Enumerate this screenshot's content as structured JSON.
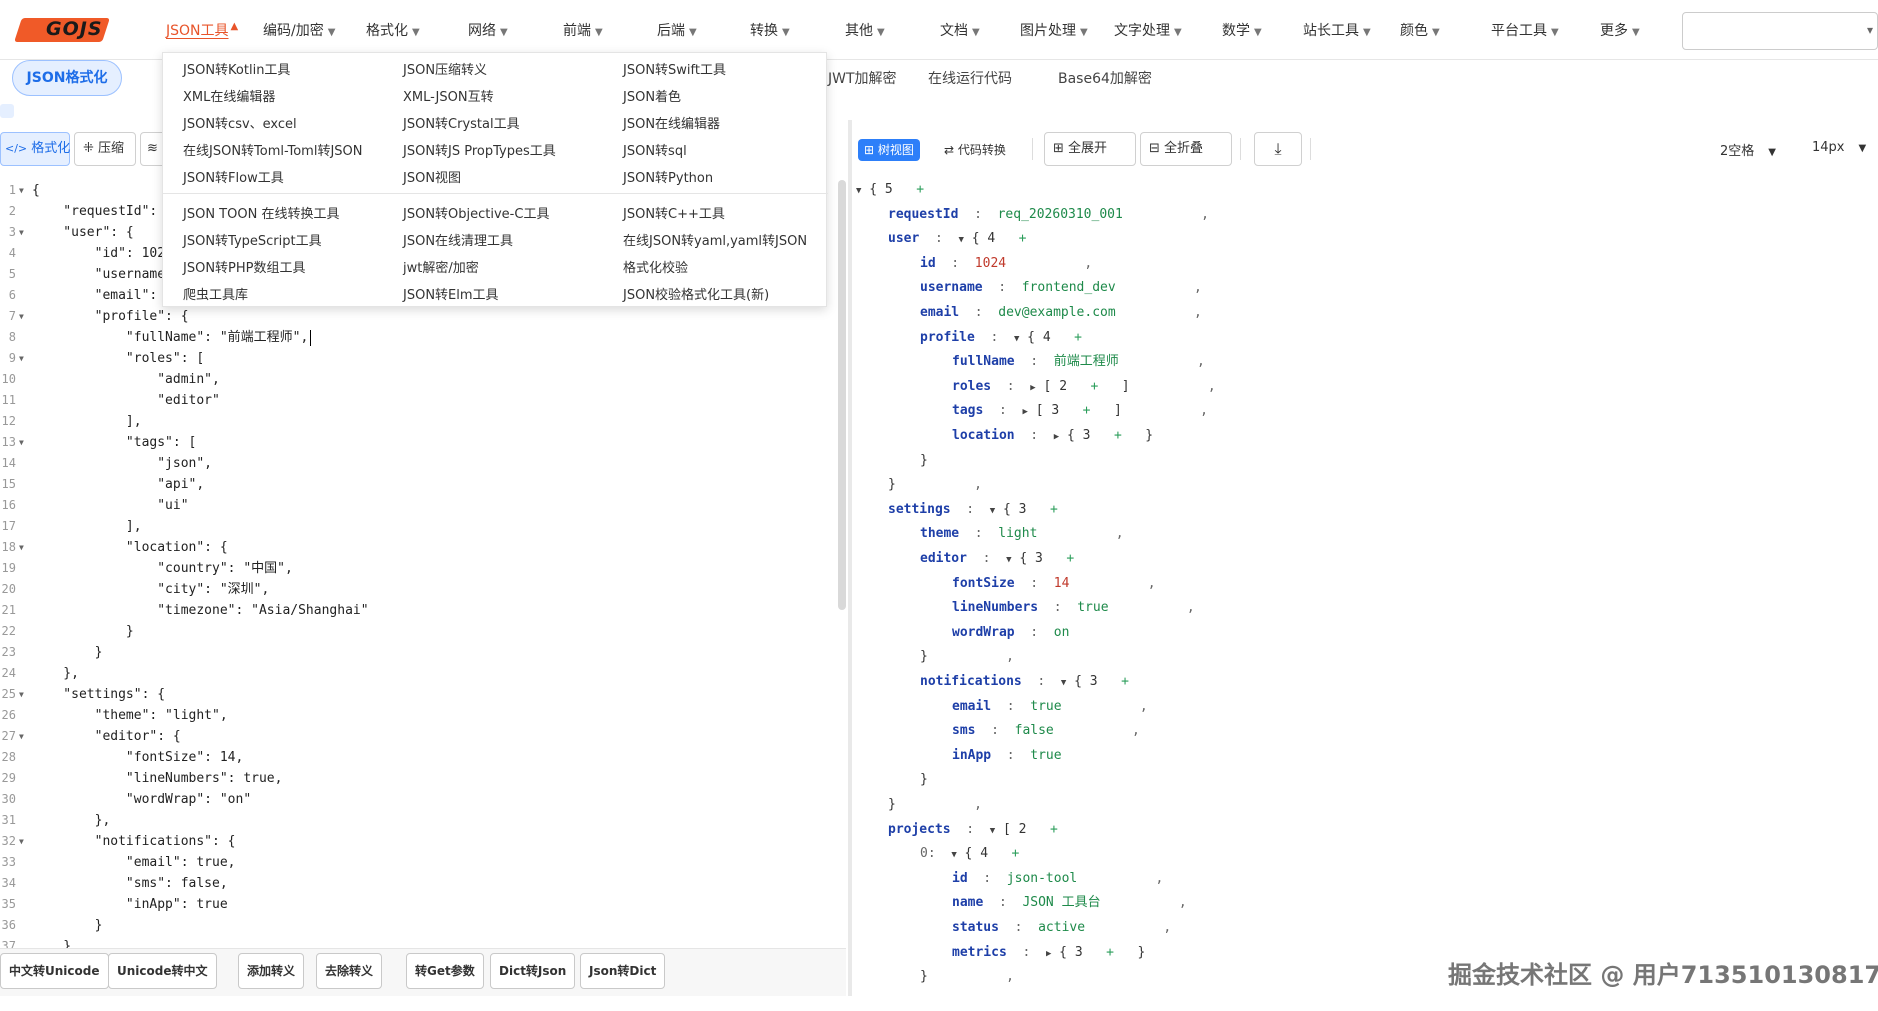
{
  "logo": {
    "text": "GOJS"
  },
  "nav": [
    {
      "label": "JSON工具",
      "active": true
    },
    {
      "label": "编码/加密"
    },
    {
      "label": "格式化"
    },
    {
      "label": "网络"
    },
    {
      "label": "前端"
    },
    {
      "label": "后端"
    },
    {
      "label": "转换"
    },
    {
      "label": "其他"
    },
    {
      "label": "文档"
    },
    {
      "label": "图片处理"
    },
    {
      "label": "文字处理"
    },
    {
      "label": "数学"
    },
    {
      "label": "站长工具"
    },
    {
      "label": "颜色"
    },
    {
      "label": "平台工具"
    },
    {
      "label": "更多"
    }
  ],
  "subtabs": {
    "active": "JSON格式化",
    "items": [
      "JWT加解密",
      "在线运行代码",
      "Base64加解密"
    ]
  },
  "dropdown": {
    "col1": [
      "JSON转Kotlin工具",
      "XML在线编辑器",
      "JSON转csv、excel",
      "在线JSON转Toml-Toml转JSON",
      "JSON转Flow工具",
      "JSON TOON 在线转换工具",
      "JSON转TypeScript工具",
      "JSON转PHP数组工具",
      "爬虫工具库"
    ],
    "col2": [
      "JSON压缩转义",
      "XML-JSON互转",
      "JSON转Crystal工具",
      "JSON转JS PropTypes工具",
      "JSON视图",
      "JSON转Objective-C工具",
      "JSON在线清理工具",
      "jwt解密/加密",
      "JSON转Elm工具"
    ],
    "col3": [
      "JSON转Swift工具",
      "JSON着色",
      "JSON在线编辑器",
      "JSON转sql",
      "JSON转Python",
      "JSON转C++工具",
      "在线JSON转yaml,yaml转JSON",
      "格式化校验",
      "JSON校验格式化工具(新)"
    ]
  },
  "left_toolbar": {
    "format": "格式化",
    "compress": "压缩"
  },
  "right_toolbar": {
    "tree_view": "树视图",
    "code_convert": "代码转换",
    "expand_all": "全展开",
    "collapse_all": "全折叠",
    "indent": "2空格",
    "font_size": "14px"
  },
  "editor_lines": [
    {
      "n": "1",
      "fold": true,
      "code": "{"
    },
    {
      "n": "2",
      "code": "    \"requestId\":"
    },
    {
      "n": "3",
      "fold": true,
      "code": "    \"user\": {"
    },
    {
      "n": "4",
      "code": "        \"id\": 102"
    },
    {
      "n": "5",
      "code": "        \"username"
    },
    {
      "n": "6",
      "code": "        \"email\":"
    },
    {
      "n": "7",
      "fold": true,
      "code": "        \"profile\": {"
    },
    {
      "n": "8",
      "code": "            \"fullName\": \"前端工程师\","
    },
    {
      "n": "9",
      "fold": true,
      "code": "            \"roles\": ["
    },
    {
      "n": "10",
      "code": "                \"admin\","
    },
    {
      "n": "11",
      "code": "                \"editor\""
    },
    {
      "n": "12",
      "code": "            ],"
    },
    {
      "n": "13",
      "fold": true,
      "code": "            \"tags\": ["
    },
    {
      "n": "14",
      "code": "                \"json\","
    },
    {
      "n": "15",
      "code": "                \"api\","
    },
    {
      "n": "16",
      "code": "                \"ui\""
    },
    {
      "n": "17",
      "code": "            ],"
    },
    {
      "n": "18",
      "fold": true,
      "code": "            \"location\": {"
    },
    {
      "n": "19",
      "code": "                \"country\": \"中国\","
    },
    {
      "n": "20",
      "code": "                \"city\": \"深圳\","
    },
    {
      "n": "21",
      "code": "                \"timezone\": \"Asia/Shanghai\""
    },
    {
      "n": "22",
      "code": "            }"
    },
    {
      "n": "23",
      "code": "        }"
    },
    {
      "n": "24",
      "code": "    },"
    },
    {
      "n": "25",
      "fold": true,
      "code": "    \"settings\": {"
    },
    {
      "n": "26",
      "code": "        \"theme\": \"light\","
    },
    {
      "n": "27",
      "fold": true,
      "code": "        \"editor\": {"
    },
    {
      "n": "28",
      "code": "            \"fontSize\": 14,"
    },
    {
      "n": "29",
      "code": "            \"lineNumbers\": true,"
    },
    {
      "n": "30",
      "code": "            \"wordWrap\": \"on\""
    },
    {
      "n": "31",
      "code": "        },"
    },
    {
      "n": "32",
      "fold": true,
      "code": "        \"notifications\": {"
    },
    {
      "n": "33",
      "code": "            \"email\": true,"
    },
    {
      "n": "34",
      "code": "            \"sms\": false,"
    },
    {
      "n": "35",
      "code": "            \"inApp\": true"
    },
    {
      "n": "36",
      "code": "        }"
    },
    {
      "n": "37",
      "code": "    },"
    }
  ],
  "bottom_buttons": [
    "中文转Unicode",
    "Unicode转中文",
    "添加转义",
    "去除转义",
    "转Get参数",
    "Dict转Json",
    "Json转Dict"
  ],
  "tree": [
    {
      "d": 0,
      "arrow": "down",
      "open": "{",
      "count": "5",
      "plus": true
    },
    {
      "d": 1,
      "key": "requestId",
      "val": "req_20260310_001",
      "vt": "s",
      "comma": true
    },
    {
      "d": 1,
      "key": "user",
      "arrow": "down",
      "open": "{",
      "count": "4",
      "plus": true
    },
    {
      "d": 2,
      "key": "id",
      "val": "1024",
      "vt": "n",
      "comma": true
    },
    {
      "d": 2,
      "key": "username",
      "val": "frontend_dev",
      "vt": "s",
      "comma": true
    },
    {
      "d": 2,
      "key": "email",
      "val": "dev@example.com",
      "vt": "s",
      "comma": true
    },
    {
      "d": 2,
      "key": "profile",
      "arrow": "down",
      "open": "{",
      "count": "4",
      "plus": true
    },
    {
      "d": 3,
      "key": "fullName",
      "val": "前端工程师",
      "vt": "s",
      "comma": true
    },
    {
      "d": 3,
      "key": "roles",
      "arrow": "right",
      "open": "[",
      "count": "2",
      "plus": true,
      "close": "]",
      "comma": true
    },
    {
      "d": 3,
      "key": "tags",
      "arrow": "right",
      "open": "[",
      "count": "3",
      "plus": true,
      "close": "]",
      "comma": true
    },
    {
      "d": 3,
      "key": "location",
      "arrow": "right",
      "open": "{",
      "count": "3",
      "plus": true,
      "close": "}"
    },
    {
      "d": 2,
      "close": "}"
    },
    {
      "d": 1,
      "close": "}",
      "comma": true
    },
    {
      "d": 1,
      "key": "settings",
      "arrow": "down",
      "open": "{",
      "count": "3",
      "plus": true
    },
    {
      "d": 2,
      "key": "theme",
      "val": "light",
      "vt": "s",
      "comma": true
    },
    {
      "d": 2,
      "key": "editor",
      "arrow": "down",
      "open": "{",
      "count": "3",
      "plus": true
    },
    {
      "d": 3,
      "key": "fontSize",
      "val": "14",
      "vt": "n",
      "comma": true
    },
    {
      "d": 3,
      "key": "lineNumbers",
      "val": "true",
      "vt": "b",
      "comma": true
    },
    {
      "d": 3,
      "key": "wordWrap",
      "val": "on",
      "vt": "s"
    },
    {
      "d": 2,
      "close": "}",
      "comma": true
    },
    {
      "d": 2,
      "key": "notifications",
      "arrow": "down",
      "open": "{",
      "count": "3",
      "plus": true
    },
    {
      "d": 3,
      "key": "email",
      "val": "true",
      "vt": "b",
      "comma": true
    },
    {
      "d": 3,
      "key": "sms",
      "val": "false",
      "vt": "b",
      "comma": true
    },
    {
      "d": 3,
      "key": "inApp",
      "val": "true",
      "vt": "b"
    },
    {
      "d": 2,
      "close": "}"
    },
    {
      "d": 1,
      "close": "}",
      "comma": true
    },
    {
      "d": 1,
      "key": "projects",
      "arrow": "down",
      "open": "[",
      "count": "2",
      "plus": true
    },
    {
      "d": 2,
      "key": "0",
      "idx": true,
      "arrow": "down",
      "open": "{",
      "count": "4",
      "plus": true
    },
    {
      "d": 3,
      "key": "id",
      "val": "json-tool",
      "vt": "s",
      "comma": true
    },
    {
      "d": 3,
      "key": "name",
      "val": "JSON 工具台",
      "vt": "s",
      "comma": true
    },
    {
      "d": 3,
      "key": "status",
      "val": "active",
      "vt": "s",
      "comma": true
    },
    {
      "d": 3,
      "key": "metrics",
      "arrow": "right",
      "open": "{",
      "count": "3",
      "plus": true,
      "close": "}"
    },
    {
      "d": 2,
      "close": "}",
      "comma": true
    }
  ],
  "watermark": "掘金技术社区 @ 用户713510130817"
}
